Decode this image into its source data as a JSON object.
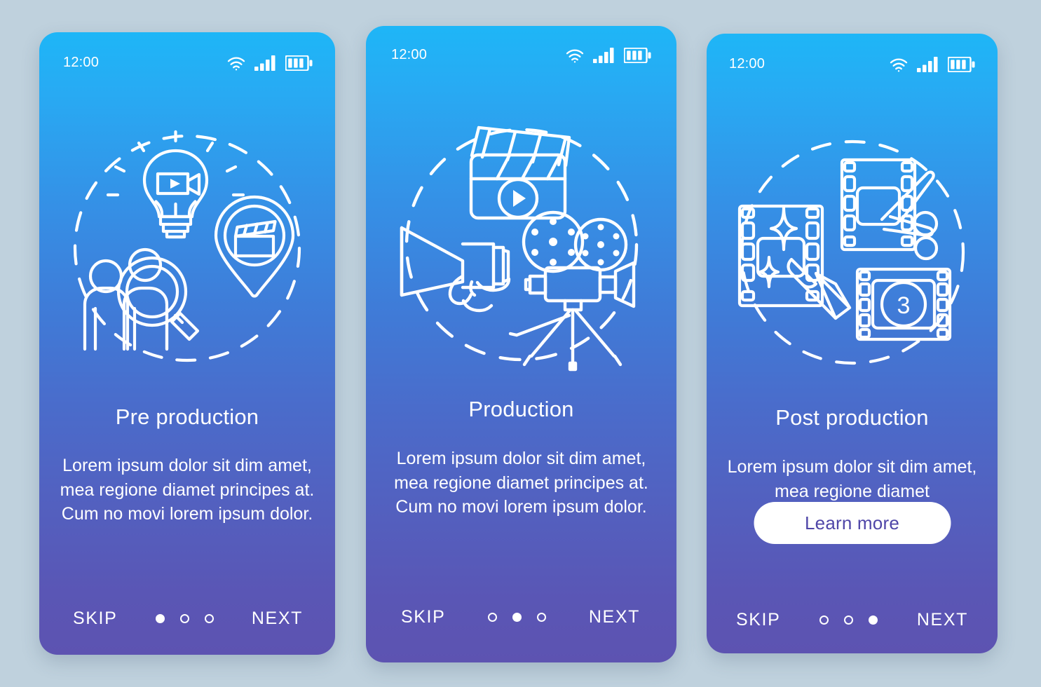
{
  "background_color": "#bfd1dd",
  "theme": {
    "gradient_top": "#1eb6f7",
    "gradient_mid": "#3f7cd8",
    "gradient_bottom": "#5d53b1",
    "stroke": "#ffffff",
    "button_bg": "#ffffff",
    "button_text": "#4f46a8"
  },
  "screens": [
    {
      "id": "pre-production",
      "status": {
        "time": "12:00",
        "icons": [
          "wifi-icon",
          "cellular-signal-icon",
          "battery-icon"
        ]
      },
      "illustration": {
        "name": "pre-production-illustration",
        "elements": [
          "lightbulb-icon",
          "video-camera-icon",
          "location-pin-icon",
          "clapperboard-icon",
          "people-icon",
          "magnifier-icon",
          "dashed-circle"
        ]
      },
      "title": "Pre production",
      "body": "Lorem ipsum dolor sit dim amet, mea regione diamet principes at. Cum no movi lorem ipsum dolor.",
      "cta": null,
      "nav": {
        "skip_label": "SKIP",
        "next_label": "NEXT",
        "dots": 3,
        "active_dot": 0
      }
    },
    {
      "id": "production",
      "status": {
        "time": "12:00",
        "icons": [
          "wifi-icon",
          "cellular-signal-icon",
          "battery-icon"
        ]
      },
      "illustration": {
        "name": "production-illustration",
        "elements": [
          "clapperboard-play-icon",
          "megaphone-icon",
          "movie-camera-tripod-icon",
          "dashed-circle"
        ]
      },
      "title": "Production",
      "body": "Lorem ipsum dolor sit dim amet, mea regione diamet principes at. Cum no movi lorem ipsum dolor.",
      "cta": null,
      "nav": {
        "skip_label": "SKIP",
        "next_label": "NEXT",
        "dots": 3,
        "active_dot": 1
      }
    },
    {
      "id": "post-production",
      "status": {
        "time": "12:00",
        "icons": [
          "wifi-icon",
          "cellular-signal-icon",
          "battery-icon"
        ]
      },
      "illustration": {
        "name": "post-production-illustration",
        "elements": [
          "film-frame-brush-icon",
          "film-frame-scissors-icon",
          "film-countdown-icon",
          "dashed-circle"
        ],
        "countdown_number": "3"
      },
      "title": "Post production",
      "body": "Lorem ipsum dolor sit dim amet, mea regione diamet",
      "cta": "Learn more",
      "nav": {
        "skip_label": "SKIP",
        "next_label": "NEXT",
        "dots": 3,
        "active_dot": 2
      }
    }
  ]
}
